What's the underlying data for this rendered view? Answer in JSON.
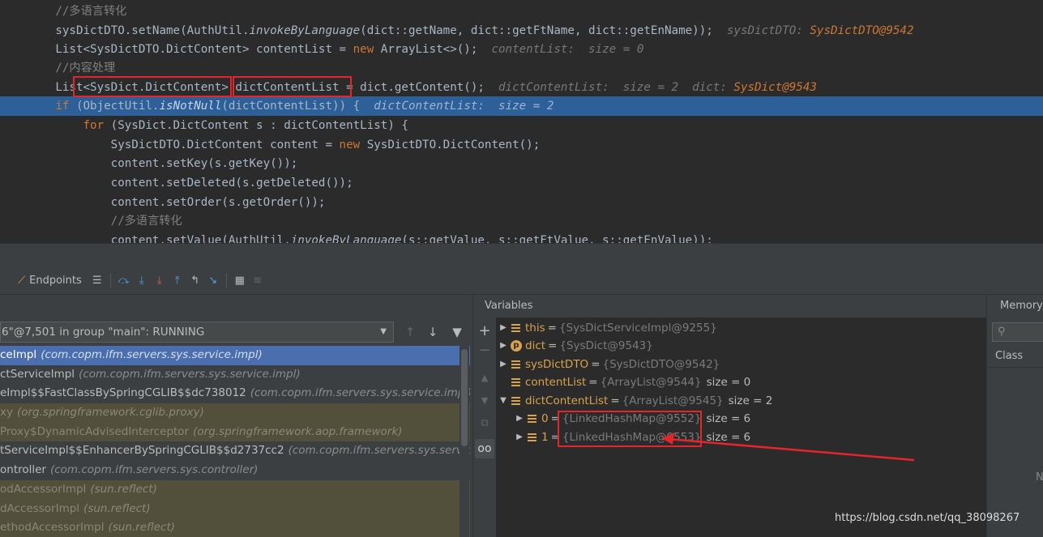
{
  "editor": {
    "lines": [
      {
        "parts": [
          {
            "t": "        //多语言转化",
            "c": "cm"
          }
        ]
      },
      {
        "parts": [
          {
            "t": "        sysDictDTO.setName(AuthUtil."
          },
          {
            "t": "invokeByLanguage",
            "c": "it"
          },
          {
            "t": "(dict::getName, dict::getFtName, dict::getEnName));  "
          },
          {
            "t": "sysDictDTO: ",
            "c": "inl"
          },
          {
            "t": "SysDictDTO@9542",
            "c": "inl-v"
          }
        ]
      },
      {
        "parts": [
          {
            "t": "        List<SysDictDTO.DictContent> contentList = "
          },
          {
            "t": "new",
            "c": "kw"
          },
          {
            "t": " ArrayList<>();  "
          },
          {
            "t": "contentList:  size = 0",
            "c": "inl"
          }
        ]
      },
      {
        "parts": [
          {
            "t": "        //内容处理",
            "c": "cm"
          }
        ]
      },
      {
        "parts": [
          {
            "t": "        List<SysDict.DictContent> dictContentList = dict.getContent();  "
          },
          {
            "t": "dictContentList:  size = 2  dict: ",
            "c": "inl"
          },
          {
            "t": "SysDict@9543",
            "c": "inl-v"
          }
        ]
      },
      {
        "hl": true,
        "parts": [
          {
            "t": "        "
          },
          {
            "t": "if",
            "c": "kw"
          },
          {
            "t": " (ObjectUtil."
          },
          {
            "t": "isNotNull",
            "c": "it"
          },
          {
            "t": "(dictContentList)) {  "
          },
          {
            "t": "dictContentList:  size = 2",
            "c": "inl"
          }
        ]
      },
      {
        "parts": [
          {
            "t": "            "
          },
          {
            "t": "for",
            "c": "kw"
          },
          {
            "t": " (SysDict.DictContent s : dictContentList) {"
          }
        ]
      },
      {
        "parts": [
          {
            "t": "                SysDictDTO.DictContent content = "
          },
          {
            "t": "new",
            "c": "kw"
          },
          {
            "t": " SysDictDTO.DictContent();"
          }
        ]
      },
      {
        "parts": [
          {
            "t": "                content.setKey(s.getKey());"
          }
        ]
      },
      {
        "parts": [
          {
            "t": "                content.setDeleted(s.getDeleted());"
          }
        ]
      },
      {
        "parts": [
          {
            "t": "                content.setOrder(s.getOrder());"
          }
        ]
      },
      {
        "parts": [
          {
            "t": "                //多语言转化",
            "c": "cm"
          }
        ]
      },
      {
        "parts": [
          {
            "t": "                content.setValue(AuthUtil."
          },
          {
            "t": "invokeByLanguage",
            "c": "it"
          },
          {
            "t": "(s::getValue, s::getFtValue, s::getEnValue));"
          }
        ]
      }
    ]
  },
  "toolbar": {
    "endpoints_label": "Endpoints"
  },
  "frames": {
    "thread_label": "6\"@7,501 in group \"main\": RUNNING",
    "items": [
      {
        "name": "ceImpl",
        "pkg": "(com.copm.ifm.servers.sys.service.impl)",
        "kind": "sel"
      },
      {
        "name": "ctServiceImpl",
        "pkg": "(com.copm.ifm.servers.sys.service.impl)",
        "kind": ""
      },
      {
        "name": "eImpl$$FastClassBySpringCGLIB$$dc738012",
        "pkg": "(com.copm.ifm.servers.sys.service.impl)",
        "kind": ""
      },
      {
        "name": "xy",
        "pkg": "(org.springframework.cglib.proxy)",
        "kind": "lib fade"
      },
      {
        "name": "Proxy$DynamicAdvisedInterceptor",
        "pkg": "(org.springframework.aop.framework)",
        "kind": "lib fade"
      },
      {
        "name": "tServiceImpl$$EnhancerBySpringCGLIB$$d2737cc2",
        "pkg": "(com.copm.ifm.servers.sys.service.im",
        "kind": ""
      },
      {
        "name": "ontroller",
        "pkg": "(com.copm.ifm.servers.sys.controller)",
        "kind": ""
      },
      {
        "name": "odAccessorImpl",
        "pkg": "(sun.reflect)",
        "kind": "lib fade"
      },
      {
        "name": "dAccessorImpl",
        "pkg": "(sun.reflect)",
        "kind": "lib fade"
      },
      {
        "name": "ethodAccessorImpl",
        "pkg": "(sun.reflect)",
        "kind": "lib fade"
      }
    ]
  },
  "variables": {
    "title": "Variables",
    "rows": [
      {
        "name": "this",
        "value": "{SysDictServiceImpl@9255}",
        "size": "",
        "icon": "field",
        "expand": "right",
        "indent": 0
      },
      {
        "name": "dict",
        "value": "{SysDict@9543}",
        "size": "",
        "icon": "p",
        "expand": "right",
        "indent": 0
      },
      {
        "name": "sysDictDTO",
        "value": "{SysDictDTO@9542}",
        "size": "",
        "icon": "field",
        "expand": "right",
        "indent": 0
      },
      {
        "name": "contentList",
        "value": "{ArrayList@9544}",
        "size": "size = 0",
        "icon": "field",
        "expand": "none",
        "indent": 0
      },
      {
        "name": "dictContentList",
        "value": "{ArrayList@9545}",
        "size": "size = 2",
        "icon": "field",
        "expand": "down",
        "indent": 0
      },
      {
        "name": "0",
        "value": "{LinkedHashMap@9552}",
        "size": "size = 6",
        "icon": "field",
        "expand": "right",
        "indent": 1
      },
      {
        "name": "1",
        "value": "{LinkedHashMap@9553}",
        "size": "size = 6",
        "icon": "field",
        "expand": "right",
        "indent": 1
      }
    ]
  },
  "memory": {
    "title": "Memory",
    "column": "Class",
    "edge_letter": "N"
  },
  "watermark": "https://blog.csdn.net/qq_38098267",
  "colors": {
    "highlight_line": "#2d6099",
    "selected_frame": "#4b6eaf",
    "annotation_red": "#e3262b",
    "field_gold": "#d8a34c"
  }
}
